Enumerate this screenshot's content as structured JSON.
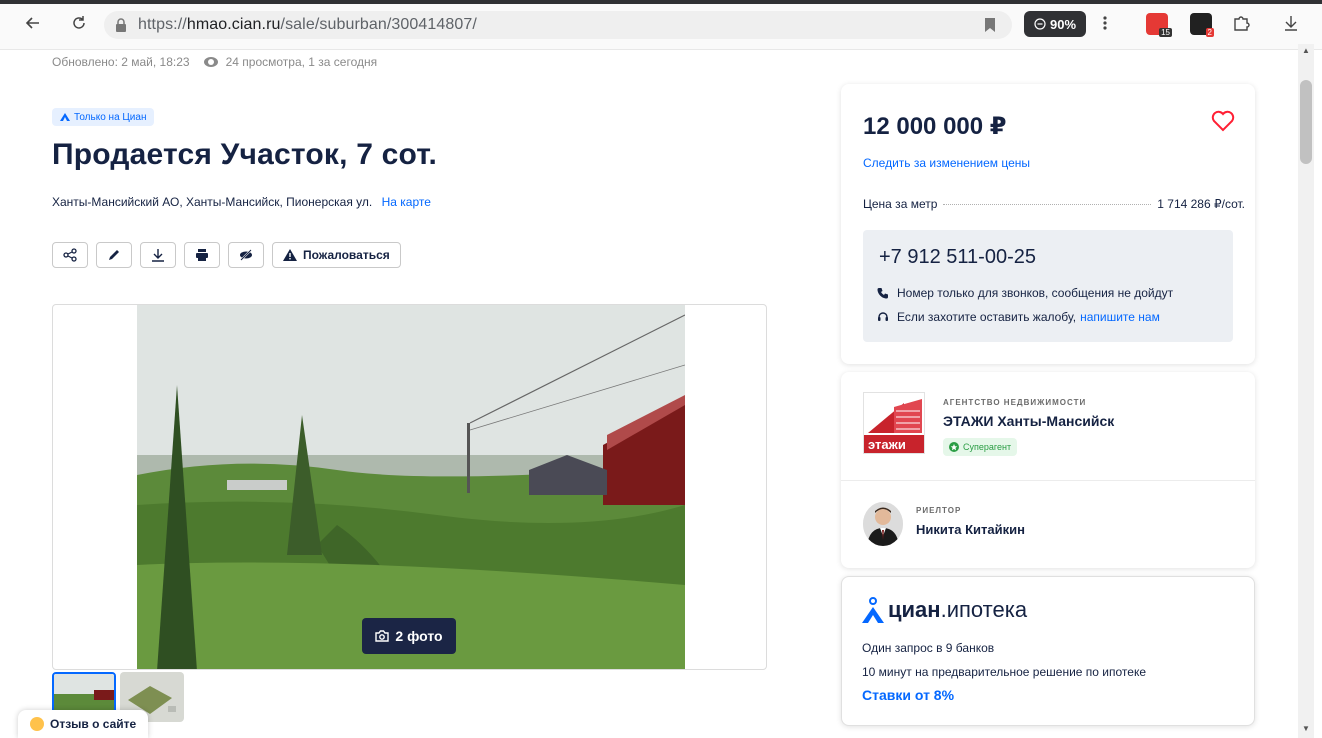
{
  "browser": {
    "url_prefix": "https://",
    "url_host": "hmao.cian.ru",
    "url_path": "/sale/suburban/300414807/",
    "zoom": "90%",
    "ext_badge_1": "15",
    "ext_badge_2": "2"
  },
  "meta": {
    "updated": "Обновлено: 2 май, 18:23",
    "views": "24 просмотра, 1 за сегодня"
  },
  "listing": {
    "badge": "Только на Циан",
    "title": "Продается Участок, 7 сот.",
    "address": "Ханты-Мансийский АО, Ханты-Мансийск, Пионерская ул.",
    "map_link": "На карте",
    "complain_label": "Пожаловаться",
    "photo_count": "2 фото"
  },
  "price_card": {
    "price": "12 000 000 ₽",
    "follow_price": "Следить за изменением цены",
    "price_per_label": "Цена за метр",
    "price_per_value": "1 714 286 ₽/сот.",
    "phone": "+7 912 511-00-25",
    "note_calls": "Номер только для звонков, сообщения не дойдут",
    "note_complaint": "Если захотите оставить жалобу,",
    "note_complaint_link": "напишите нам"
  },
  "agent_card": {
    "agency_caption": "АГЕНТСТВО НЕДВИЖИМОСТИ",
    "agency_name": "ЭТАЖИ Ханты-Мансийск",
    "agency_logo_text": "этажи",
    "superagent": "Суперагент",
    "realtor_caption": "РИЕЛТОР",
    "realtor_name": "Никита Китайкин"
  },
  "mortgage_card": {
    "brand": "циан",
    "brand_rest": ".ипотека",
    "line1": "Один запрос в 9 банков",
    "line2": "10 минут на предварительное решение по ипотеке",
    "rates": "Ставки от 8%"
  },
  "feedback": {
    "label": "Отзыв о сайте"
  },
  "colors": {
    "accent": "#0468ff",
    "heading": "#152242",
    "heart": "#ff1f34",
    "superagent_green": "#2a9d44"
  }
}
